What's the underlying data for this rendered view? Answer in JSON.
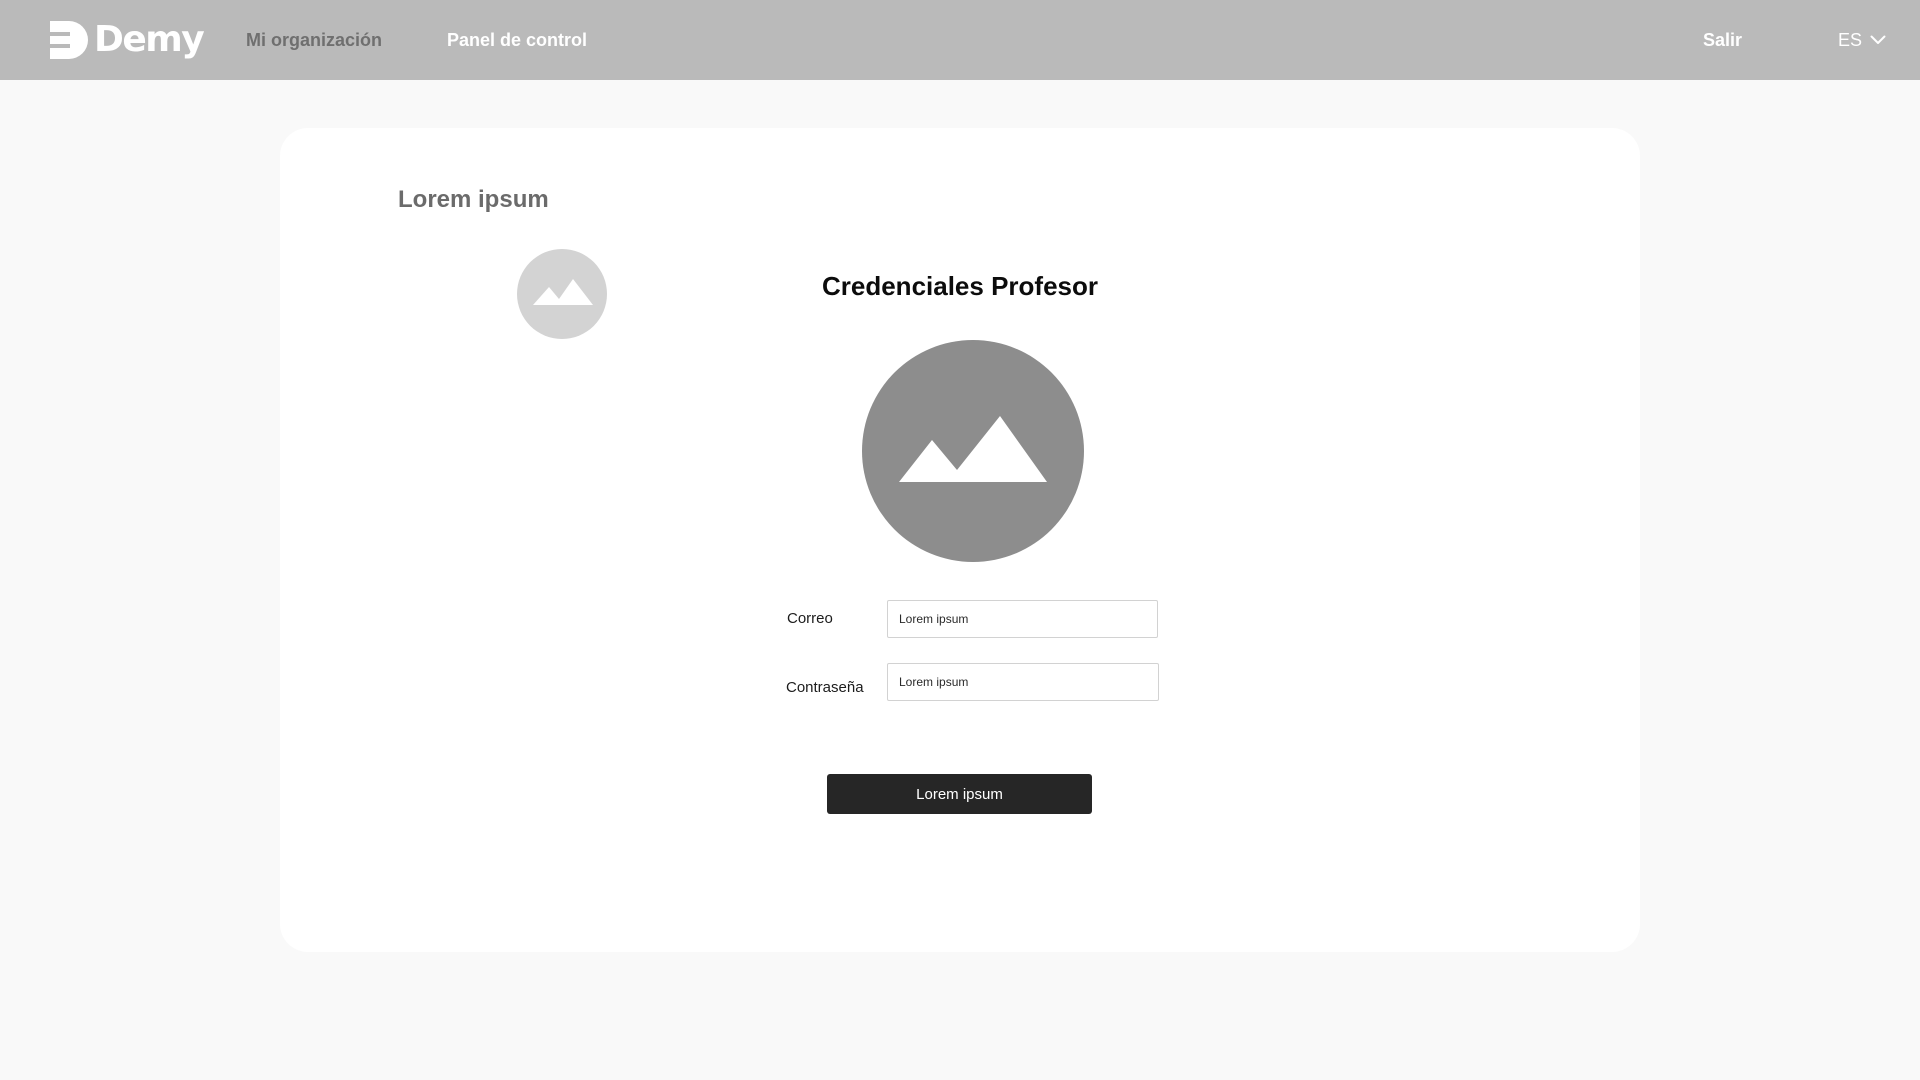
{
  "header": {
    "brand": "Demy",
    "nav": {
      "organization": "Mi organización",
      "control_panel": "Panel de control"
    },
    "logout": "Salir",
    "language": "ES"
  },
  "main": {
    "title": "Lorem ipsum",
    "section_title": "Credenciales Profesor",
    "form": {
      "email_label": "Correo",
      "email_placeholder": "Lorem ipsum",
      "password_label": "Contraseña",
      "password_placeholder": "Lorem ipsum",
      "submit_label": "Lorem ipsum"
    }
  },
  "icons": {
    "logo": "demy-logo-icon",
    "language_caret": "chevron-down-icon",
    "placeholder_image": "image-placeholder-icon"
  },
  "colors": {
    "header_bg": "#bababa",
    "page_bg": "#f9f9f9",
    "card_bg": "#ffffff",
    "button_bg": "#262626",
    "avatar_small": "#d3d3d3",
    "avatar_large": "#8d8d8d"
  }
}
